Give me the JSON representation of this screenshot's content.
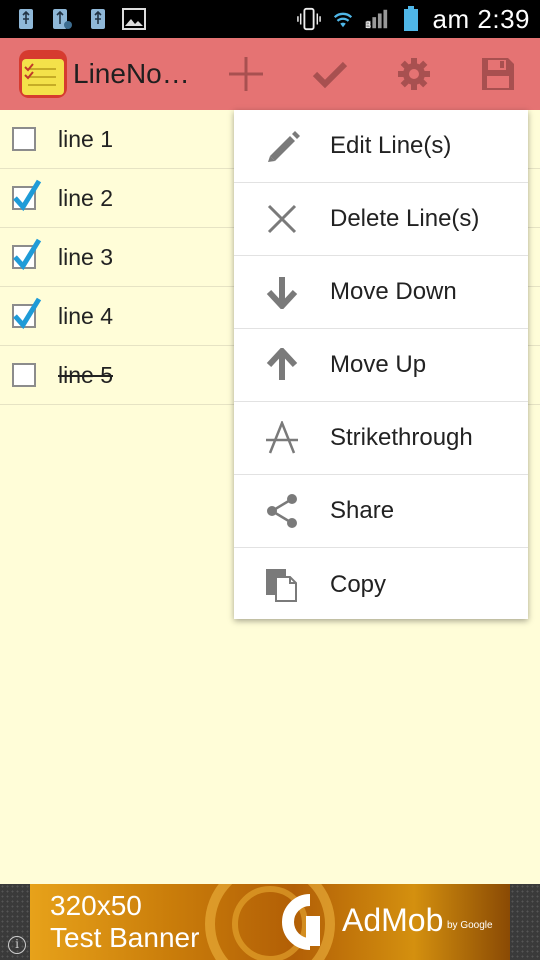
{
  "status_bar": {
    "left_icons": [
      "usb-icon",
      "usb-debug-icon",
      "usb-icon",
      "image-icon"
    ],
    "right_icons": [
      "vibrate-icon",
      "wifi-icon",
      "signal-icon",
      "battery-icon"
    ],
    "time": "am 2:39"
  },
  "action_bar": {
    "title": "LineNo…",
    "buttons": [
      "add-icon",
      "check-icon",
      "gear-icon",
      "save-icon"
    ],
    "color": "#e57373"
  },
  "lines": [
    {
      "text": "line 1",
      "checked": false,
      "strikethrough": false
    },
    {
      "text": "line 2",
      "checked": true,
      "strikethrough": false
    },
    {
      "text": "line 3",
      "checked": true,
      "strikethrough": false
    },
    {
      "text": "line 4",
      "checked": true,
      "strikethrough": false
    },
    {
      "text": "line 5",
      "checked": false,
      "strikethrough": true
    }
  ],
  "menu": {
    "items": [
      {
        "label": "Edit Line(s)",
        "icon": "pencil-icon"
      },
      {
        "label": "Delete Line(s)",
        "icon": "close-icon"
      },
      {
        "label": "Move Down",
        "icon": "arrow-down-icon"
      },
      {
        "label": "Move Up",
        "icon": "arrow-up-icon"
      },
      {
        "label": "Strikethrough",
        "icon": "strikethrough-icon"
      },
      {
        "label": "Share",
        "icon": "share-icon"
      },
      {
        "label": "Copy",
        "icon": "copy-icon"
      }
    ]
  },
  "ad": {
    "line1": "320x50",
    "line2": "Test Banner",
    "brand": "AdMob",
    "by": "by Google",
    "info_icon": "info-icon"
  },
  "colors": {
    "background": "#fffdd8",
    "checkmark": "#1e9bd7",
    "menu_icon": "#7a7a7a"
  }
}
